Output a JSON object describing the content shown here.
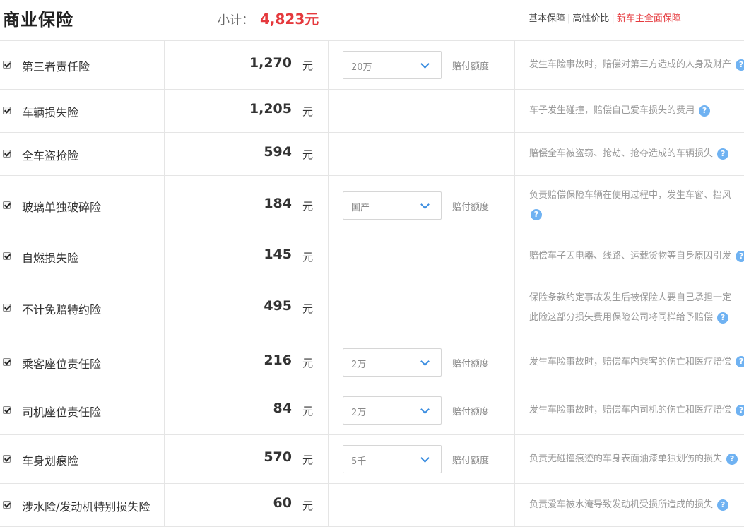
{
  "header": {
    "title": "商业保险",
    "subtotal_label": "小计：",
    "subtotal_value": "4,823元",
    "tabs": [
      "基本保障",
      "高性价比",
      "新车主全面保障"
    ],
    "active_tab": "新车主全面保障"
  },
  "rows": [
    {
      "name": "第三者责任险",
      "price": "1,270",
      "unit": "元",
      "select": "20万",
      "coverage": "赔付额度",
      "desc": "发生车险事故时，赔偿对第三方造成的人身及财产",
      "checked": true
    },
    {
      "name": "车辆损失险",
      "price": "1,205",
      "unit": "元",
      "select": "",
      "coverage": "",
      "desc": "车子发生碰撞，赔偿自己爱车损失的费用",
      "checked": true
    },
    {
      "name": "全车盗抢险",
      "price": "594",
      "unit": "元",
      "select": "",
      "coverage": "",
      "desc": "赔偿全车被盗窃、抢劫、抢夺造成的车辆损失",
      "checked": true
    },
    {
      "name": "玻璃单独破碎险",
      "price": "184",
      "unit": "元",
      "select": "国产",
      "coverage": "赔付额度",
      "desc": "负责赔偿保险车辆在使用过程中，发生车窗、挡风",
      "checked": true
    },
    {
      "name": "自燃损失险",
      "price": "145",
      "unit": "元",
      "select": "",
      "coverage": "",
      "desc": "赔偿车子因电器、线路、运载货物等自身原因引发",
      "checked": true
    },
    {
      "name": "不计免赔特约险",
      "price": "495",
      "unit": "元",
      "select": "",
      "coverage": "",
      "desc": "保险条款约定事故发生后被保险人要自己承担一定",
      "desc2": "此险这部分损失费用保险公司将同样给予赔偿",
      "checked": true
    },
    {
      "name": "乘客座位责任险",
      "price": "216",
      "unit": "元",
      "select": "2万",
      "coverage": "赔付额度",
      "desc": "发生车险事故时，赔偿车内乘客的伤亡和医疗赔偿",
      "checked": true
    },
    {
      "name": "司机座位责任险",
      "price": "84",
      "unit": "元",
      "select": "2万",
      "coverage": "赔付额度",
      "desc": "发生车险事故时，赔偿车内司机的伤亡和医疗赔偿",
      "checked": true
    },
    {
      "name": "车身划痕险",
      "price": "570",
      "unit": "元",
      "select": "5千",
      "coverage": "赔付额度",
      "desc": "负责无碰撞痕迹的车身表面油漆单独划伤的损失",
      "checked": true
    },
    {
      "name": "涉水险/发动机特别损失险",
      "price": "60",
      "unit": "元",
      "select": "",
      "coverage": "",
      "desc": "负责爱车被水淹导致发动机受损所造成的损失",
      "checked": true
    }
  ],
  "help_icon": "question-circle-icon",
  "help_glyph": "?",
  "colors": {
    "accent": "#e5393d",
    "help": "#6fb2f2"
  }
}
